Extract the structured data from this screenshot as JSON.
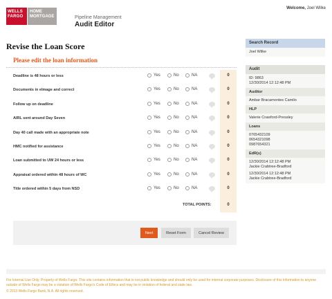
{
  "header": {
    "logo_wells": "WELLS FARGO",
    "logo_home": "HOME MORTGAGE",
    "subtitle": "Pipeline Management",
    "title": "Audit Editor",
    "welcome_label": "Welcome,",
    "user": "Joel Wilke"
  },
  "page": {
    "title": "Revise the Loan Score",
    "section_title": "Please edit the loan information"
  },
  "options": {
    "yes": "Yes",
    "no": "No",
    "na": "NA"
  },
  "questions": [
    {
      "label": "Deadline is 48 hours or less",
      "score": "0"
    },
    {
      "label": "Documents in eImage and correct",
      "score": "0"
    },
    {
      "label": "Follow up on deadline",
      "score": "0"
    },
    {
      "label": "AIRL sent around Day Seven",
      "score": "0"
    },
    {
      "label": "Day 40 call made with an appropriate note",
      "score": "0"
    },
    {
      "label": "HMC notified for assistance",
      "score": "0"
    },
    {
      "label": "Loan submitted to UW 24 hours or less",
      "score": "0"
    },
    {
      "label": "Appraisal ordered within 48 hours of WC",
      "score": "0"
    },
    {
      "label": "Title ordered within 5 days from NSD",
      "score": "0"
    }
  ],
  "total": {
    "label": "TOTAL POINTS:",
    "value": "0"
  },
  "buttons": {
    "next": "Next",
    "reset": "Reset Form",
    "cancel": "Cancel Review"
  },
  "sidebar": {
    "search_title": "Search Record",
    "search_value": "Joel Wilke",
    "audit_title": "Audit",
    "audit_id": "ID: 9863",
    "audit_date": "12/30/2014 12:12:48 PM",
    "auditor_title": "Auditor",
    "auditor_name": "Ambar Bracamontes Camilo",
    "hlp_title": "HLP",
    "hlp_name": "Valerie Crawford-Pressley",
    "loans_title": "Loans",
    "loans": [
      "0765432109",
      "0654321098",
      "0987654321"
    ],
    "edr_title": "EdR(s)",
    "edrs": [
      {
        "date": "12/30/2014 12:12:48 PM",
        "name": "Jackie Crabtree-Bradford"
      },
      {
        "date": "12/30/2014 12:12:48 PM",
        "name": "Jackie Crabtree-Bradford"
      }
    ]
  },
  "footer": {
    "notice": "For Internal Use Only. Property of Wells Fargo. This site contains information that is not public knowledge and should only be used for internal corporate purposes. Disclosure of this information to anyone outside of Wells Fargo may be a violation of Wells Fargo's Code of Ethics and may be in violation of federal and state law.",
    "copyright": "© 2013 Wells Fargo Bank, N.A. All rights reserved."
  },
  "colors": {
    "accent": "#e05a1e",
    "brand_red": "#c8102e",
    "sidebar_blue": "#c7d7e9",
    "score_bg": "#fbeedd"
  }
}
